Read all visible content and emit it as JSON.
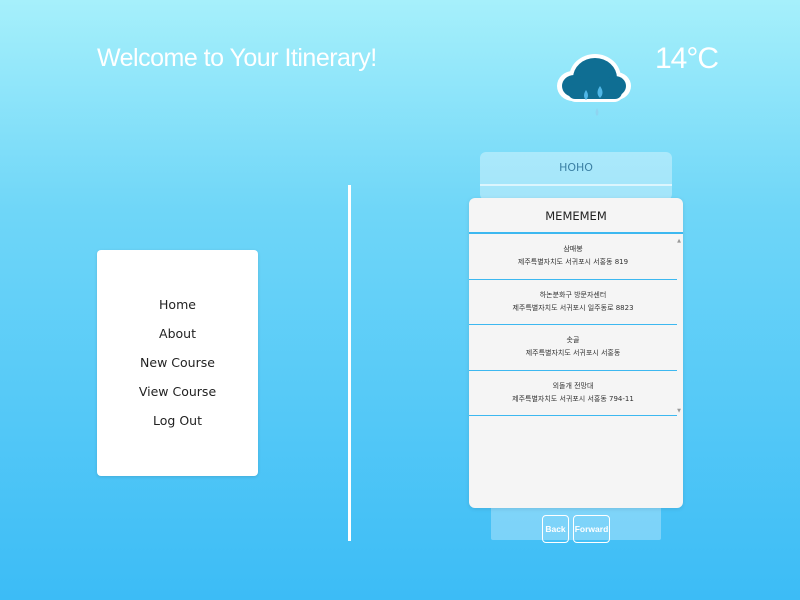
{
  "header": {
    "welcome": "Welcome to Your Itinerary!",
    "temperature": "14°C",
    "weather_icon": "rain-cloud-icon"
  },
  "menu": {
    "items": [
      {
        "label": "Home"
      },
      {
        "label": "About"
      },
      {
        "label": "New Course"
      },
      {
        "label": "View Course"
      },
      {
        "label": "Log Out"
      }
    ]
  },
  "cards": {
    "back_title": "HOHO",
    "front_title": "MEMEMEM",
    "places": [
      {
        "name": "삼매봉",
        "address": "제주특별자치도 서귀포시 서홍동 819"
      },
      {
        "name": "하논분화구 방문자센터",
        "address": "제주특별자치도 서귀포시 일주동로 8823"
      },
      {
        "name": "솟골",
        "address": "제주특별자치도 서귀포시 서홍동"
      },
      {
        "name": "외돌개 전망대",
        "address": "제주특별자치도 서귀포시 서홍동 794-11"
      }
    ]
  },
  "navigation": {
    "back_label": "Back",
    "forward_label": "Forward"
  },
  "colors": {
    "accent": "#3db8f0",
    "cloud": "#0f6e93",
    "rain": "#4fb6e6"
  }
}
